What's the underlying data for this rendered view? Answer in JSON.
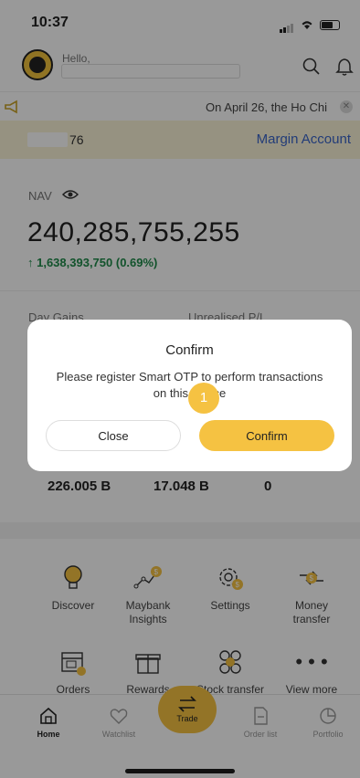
{
  "status": {
    "time": "10:37"
  },
  "header": {
    "greeting": "Hello,"
  },
  "ticker": {
    "message": "On April 26, the Ho Chi"
  },
  "account": {
    "number_suffix": "76",
    "type_link": "Margin Account"
  },
  "nav": {
    "label": "NAV",
    "value": "240,285,755,255",
    "change": "↑ 1,638,393,750 (0.69%)"
  },
  "gains": {
    "day_label": "Day Gains",
    "unrealised_label": "Unrealised P/L"
  },
  "stats": [
    "226.005 B",
    "17.048 B",
    "0"
  ],
  "menu": [
    {
      "label": "Discover",
      "icon": "lightbulb-icon"
    },
    {
      "label": "Maybank\nInsights",
      "icon": "insights-icon"
    },
    {
      "label": "Settings",
      "icon": "settings-gear-icon"
    },
    {
      "label": "Money\ntransfer",
      "icon": "money-transfer-icon"
    }
  ],
  "menu_row2": [
    {
      "label": "Orders",
      "icon": "calendar-check-icon"
    },
    {
      "label": "Rewards",
      "icon": "gift-icon"
    },
    {
      "label": "Stock transfer",
      "icon": "stock-transfer-icon"
    },
    {
      "label": "View more",
      "icon": "more-dots-icon"
    }
  ],
  "tabs": {
    "home": "Home",
    "watchlist": "Watchlist",
    "trade": "Trade",
    "orders": "Order list",
    "portfolio": "Portfolio"
  },
  "dialog": {
    "title": "Confirm",
    "message": "Please register Smart OTP to perform transactions on this device",
    "close": "Close",
    "confirm": "Confirm"
  },
  "marker": "1",
  "colors": {
    "accent": "#f5c242",
    "link": "#3a64c8",
    "positive": "#1f8a4a",
    "account_bg": "#fbf4d8"
  }
}
